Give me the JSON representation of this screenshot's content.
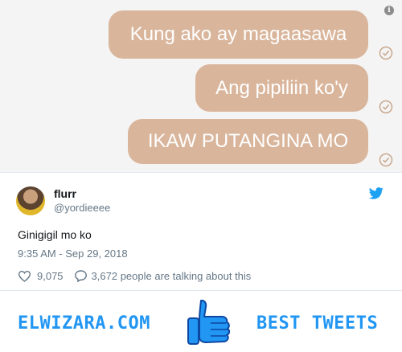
{
  "chat": {
    "messages": [
      "Kung ako ay magaasawa",
      "Ang pipiliin ko'y",
      "IKAW PUTANGINA MO"
    ],
    "info_icon": "info-icon",
    "read_icon": "check-circle-icon",
    "bubble_color": "#d9b59b"
  },
  "tweet": {
    "name": "flurr",
    "handle": "@yordieeee",
    "text": "Ginigigil mo ko",
    "timestamp": "9:35 AM - Sep 29, 2018",
    "likes": "9,075",
    "replies_text": "3,672 people are talking about this",
    "like_icon": "heart-icon",
    "reply_icon": "comment-icon",
    "platform_icon": "twitter-bird-icon",
    "brand_color": "#1da1f2"
  },
  "footer": {
    "site": "ELWIZARA.COM",
    "tagline": "BEST TWEETS",
    "icon": "thumbs-up-icon",
    "accent": "#2196f3"
  }
}
